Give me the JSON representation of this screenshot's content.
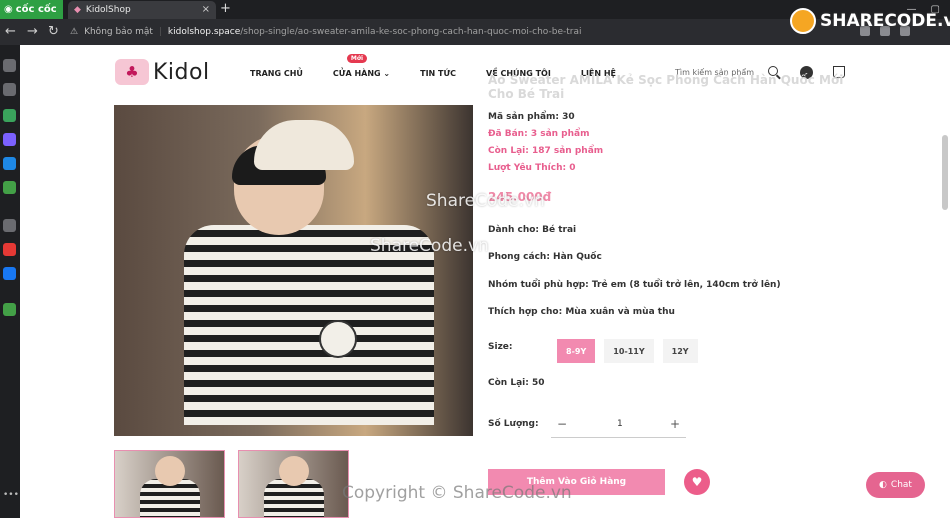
{
  "browser": {
    "brand": "cốc cốc",
    "tab_title": "KidolShop",
    "tab_close": "×",
    "new_tab": "+",
    "security_label": "Không bảo mật",
    "url_host": "kidolshop.space",
    "url_path": "/shop-single/ao-sweater-amila-ke-soc-phong-cach-han-quoc-moi-cho-be-trai"
  },
  "header": {
    "logo_text": "Kidol",
    "nav": [
      {
        "label": "TRANG CHỦ"
      },
      {
        "label": "CỬA HÀNG",
        "badge": "Mới"
      },
      {
        "label": "TIN TỨC"
      },
      {
        "label": "VỀ CHÚNG TÔI"
      },
      {
        "label": "LIÊN HỆ"
      }
    ],
    "search_placeholder": "Tìm kiếm sản phẩm"
  },
  "product": {
    "title": "Áo Sweater AMILA Kẻ Sọc Phong Cách Hàn Quốc Mới Cho Bé Trai",
    "code": "Mã sản phẩm: 30",
    "sold": "Đã Bán: 3 sản phẩm",
    "remaining": "Còn Lại: 187 sản phẩm",
    "likes": "Lượt Yêu Thích: 0",
    "price": "245.000đ",
    "for": "Dành cho: Bé trai",
    "style": "Phong cách: Hàn Quốc",
    "age_group": "Nhóm tuổi phù hợp: Trẻ em (8 tuổi trở lên, 140cm trở lên)",
    "season": "Thích hợp cho: Mùa xuân và mùa thu",
    "size_label": "Size:",
    "sizes": [
      "8-9Y",
      "10-11Y",
      "12Y"
    ],
    "size_remaining": "Còn Lại: 50",
    "qty_label": "Số Lượng:",
    "qty_minus": "−",
    "qty_value": "1",
    "qty_plus": "+",
    "add_to_cart": "Thêm Vào Giỏ Hàng",
    "heart": "♥"
  },
  "chat": {
    "label": "Chat"
  },
  "watermarks": {
    "wm1": "ShareCode.vn",
    "wm2": "ShareCode.vn",
    "wm3": "Copyright © ShareCode.vn",
    "logo": "SHARECODE.vn"
  },
  "colors": {
    "accent": "#f28ab0",
    "pink_text": "#e85e8e"
  }
}
